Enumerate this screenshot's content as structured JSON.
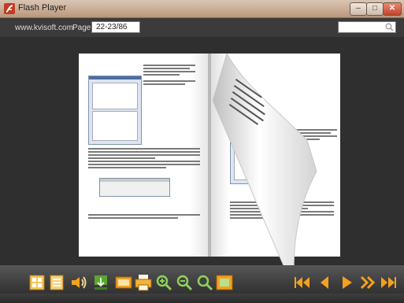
{
  "window": {
    "title": "Flash Player"
  },
  "topbar": {
    "site": "www.kvisoft.com",
    "page_label": "Page:",
    "page_value": "22-23/86"
  },
  "left_page": {
    "text": "Для обеспечения работы со ссылками в Батарее пользователь имеет меню ввода различных гиперссылок, а для вставки выберите в поле Гиперссылку, Удалите гиперссылку. Размер ячейки Лист и Страница подставляется в соответствии для окна окна Вход-Вход под данные ячеек. Работа в диалоговом окне «Ссылки». Для работы со ссылками нажмите на кнопку мыши «Ссылки».",
    "caption": "Ссылки – это фрагменты текста, которые ссылаются на страницы, расположенные вне и внутри документа."
  },
  "right_page": {
    "text": "При форматировании многостраничного текста, чтобы не было разрывов при перелистывании, необходимо пользоваться пунктом Вставка – Разрыв страницы и настраивать параметры абзаца в диалоговом окне «Абзац»."
  },
  "toolbar": {
    "left_icons": [
      "thumbnails-icon",
      "table-of-contents-icon",
      "sound-icon",
      "download-icon",
      "slideshow-icon",
      "print-icon",
      "zoom-in-icon",
      "zoom-out-icon",
      "search-zoom-icon",
      "fit-page-icon"
    ],
    "nav_icons": [
      "first-page-icon",
      "previous-page-icon",
      "play-icon",
      "next-page-icon",
      "last-page-icon"
    ],
    "accent": "#f4a11f",
    "icon_green": "#5aa531"
  }
}
